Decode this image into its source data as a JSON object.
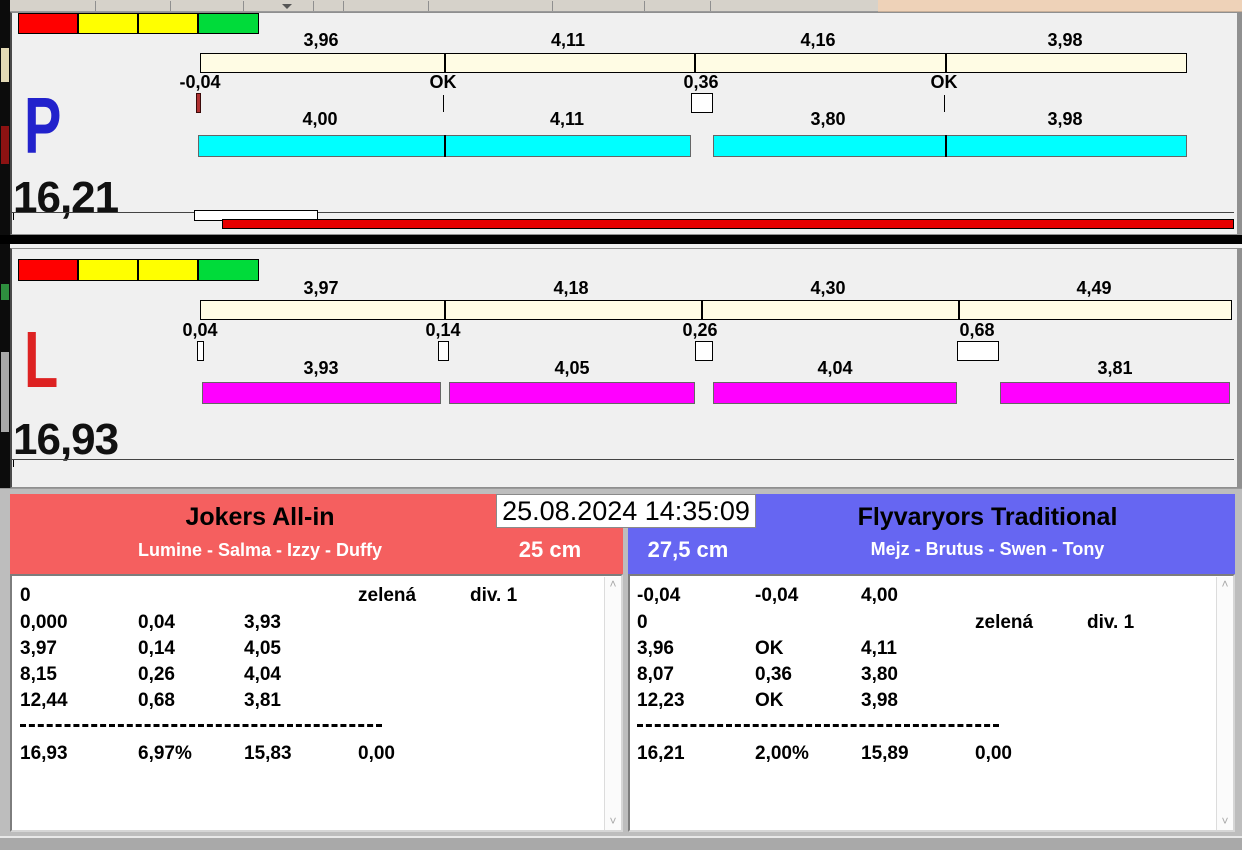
{
  "window": {
    "datetime": "25.08.2024 14:35:09"
  },
  "lanes": [
    {
      "letter": "P",
      "letter_color": "#2222cc",
      "total": "16,21",
      "segment_values_top": [
        "3,96",
        "4,11",
        "4,16",
        "3,98"
      ],
      "gap_labels": [
        "-0,04",
        "OK",
        "0,36",
        "OK"
      ],
      "segment_values_bottom": [
        "4,00",
        "4,11",
        "3,80",
        "3,98"
      ],
      "bar_color": "#00ffff"
    },
    {
      "letter": "L",
      "letter_color": "#dd2222",
      "total": "16,93",
      "segment_values_top": [
        "3,97",
        "4,18",
        "4,30",
        "4,49"
      ],
      "gap_labels": [
        "0,04",
        "0,14",
        "0,26",
        "0,68"
      ],
      "segment_values_bottom": [
        "3,93",
        "4,05",
        "4,04",
        "3,81"
      ],
      "bar_color": "#ff00ff"
    }
  ],
  "teams": [
    {
      "name": "Jokers All-in",
      "members": "Lumine - Salma - Izzy - Duffy",
      "lane_length": "25 cm",
      "header_color": "#f55f5f",
      "rows": [
        [
          "0",
          "",
          "",
          "zelená",
          "div. 1"
        ],
        [
          "0,000",
          "0,04",
          "3,93",
          "",
          ""
        ],
        [
          "3,97",
          "0,14",
          "4,05",
          "",
          ""
        ],
        [
          "8,15",
          "0,26",
          "4,04",
          "",
          ""
        ],
        [
          "12,44",
          "0,68",
          "3,81",
          "",
          ""
        ]
      ],
      "totals": [
        "16,93",
        "6,97%",
        "15,83",
        "0,00"
      ]
    },
    {
      "name": "Flyvaryors Traditional",
      "members": "Mejz - Brutus - Swen - Tony",
      "lane_length": "27,5 cm",
      "header_color": "#6666f2",
      "rows": [
        [
          "-0,04",
          "-0,04",
          "4,00",
          "",
          ""
        ],
        [
          "0",
          "",
          "",
          "zelená",
          "div. 1"
        ],
        [
          "3,96",
          "OK",
          "4,11",
          "",
          ""
        ],
        [
          "8,07",
          "0,36",
          "3,80",
          "",
          ""
        ],
        [
          "12,23",
          "OK",
          "3,98",
          "",
          ""
        ]
      ],
      "totals": [
        "16,21",
        "2,00%",
        "15,89",
        "0,00"
      ]
    }
  ],
  "scrollbar": {
    "up_arrow": "˄",
    "down_arrow": "˅"
  },
  "colors": {
    "lane_p_bar": "#00ffff",
    "lane_l_bar": "#ff00ff",
    "segment_bar": "#fffce4",
    "team_left_header": "#f55f5f",
    "team_right_header": "#6666f2",
    "indicator_red": "#ff0000",
    "indicator_yellow": "#ffff00",
    "indicator_green": "#00db3a",
    "progress_red": "#e60000"
  }
}
